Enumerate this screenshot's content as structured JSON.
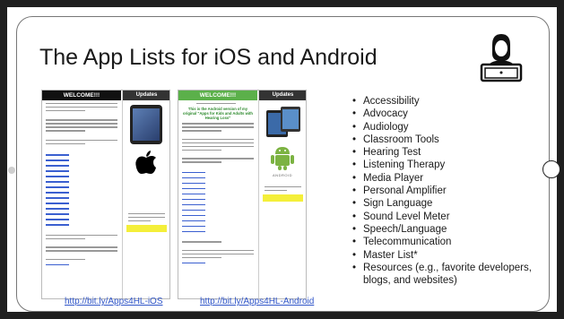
{
  "slide": {
    "title": "The App Lists for iOS and Android"
  },
  "thumbnails": {
    "ios": {
      "header_left": "WELCOME!!!",
      "header_right": "Updates",
      "caption": "http://bit.ly/Apps4HL-iOS"
    },
    "android": {
      "header_left": "WELCOME!!!",
      "header_right": "Updates",
      "tagline": "This is the Android version of my original \"Apps for Kids and Adults with Hearing Loss\"",
      "logo_text": "ANDROID",
      "caption": "http://bit.ly/Apps4HL-Android"
    }
  },
  "categories": [
    "Accessibility",
    "Advocacy",
    "Audiology",
    "Classroom Tools",
    "Hearing Test",
    "Listening Therapy",
    "Media Player",
    "Personal Amplifier",
    "Sign Language",
    "Sound Level Meter",
    "Speech/Language",
    "Telecommunication",
    "Master List*",
    "Resources (e.g., favorite developers, blogs, and websites)"
  ],
  "colors": {
    "link": "#2f55c8",
    "android_green": "#5bb04a",
    "highlight": "#f4ef3a"
  },
  "icons": {
    "presenter": "presenter-at-laptop-icon",
    "apple": "apple-logo-icon",
    "android": "android-robot-icon"
  }
}
